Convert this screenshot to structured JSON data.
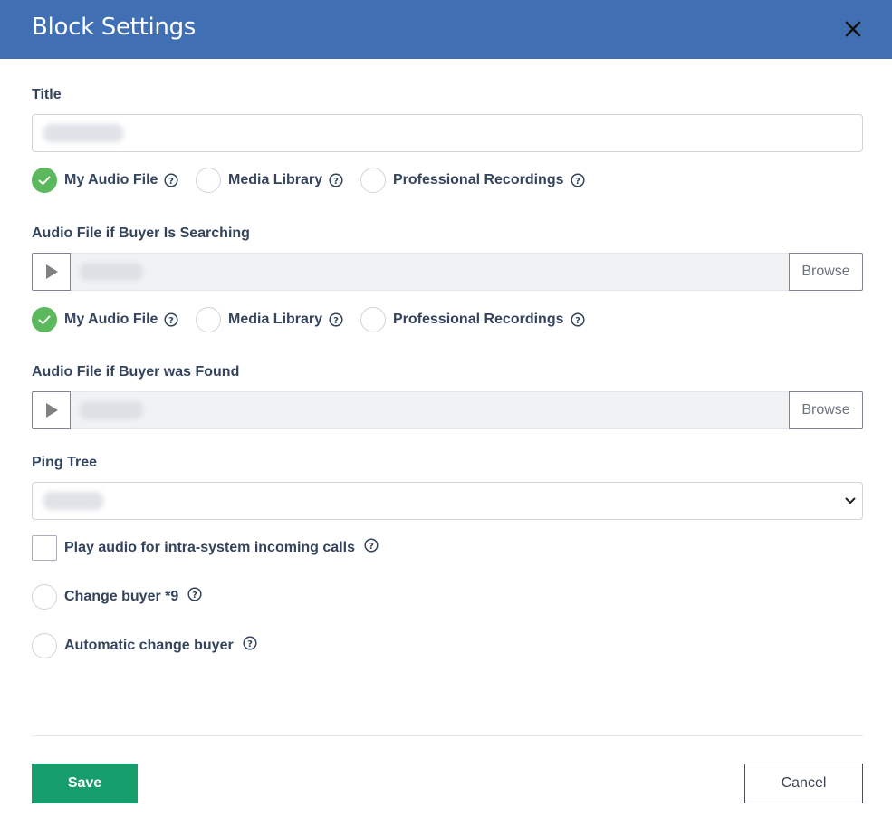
{
  "dialog": {
    "title": "Block Settings",
    "close_icon": "close-icon"
  },
  "title_field": {
    "label": "Title",
    "value": "Ping Tree (blurred)"
  },
  "source_options_1": {
    "my_audio": "My Audio File",
    "media_library": "Media Library",
    "professional": "Professional Recordings",
    "selected": "My Audio File"
  },
  "audio_searching": {
    "label": "Audio File if Buyer Is Searching",
    "value": "No Audio (blurred)",
    "browse_label": "Browse"
  },
  "source_options_2": {
    "my_audio": "My Audio File",
    "media_library": "Media Library",
    "professional": "Professional Recordings",
    "selected": "My Audio File"
  },
  "audio_found": {
    "label": "Audio File if Buyer was Found",
    "value": "No Audio (blurred)",
    "browse_label": "Browse"
  },
  "ping_tree": {
    "label": "Ping Tree",
    "selected": "Default (blurred)"
  },
  "options": {
    "play_audio_label": "Play audio for intra-system incoming calls",
    "play_audio_checked": false,
    "change_buyer_label": "Change buyer *9",
    "change_buyer_checked": false,
    "auto_change_label": "Automatic change buyer",
    "auto_change_checked": false
  },
  "footer": {
    "save_label": "Save",
    "cancel_label": "Cancel"
  },
  "colors": {
    "header": "#416fb4",
    "check": "#5cb85c",
    "save": "#159e6b"
  }
}
